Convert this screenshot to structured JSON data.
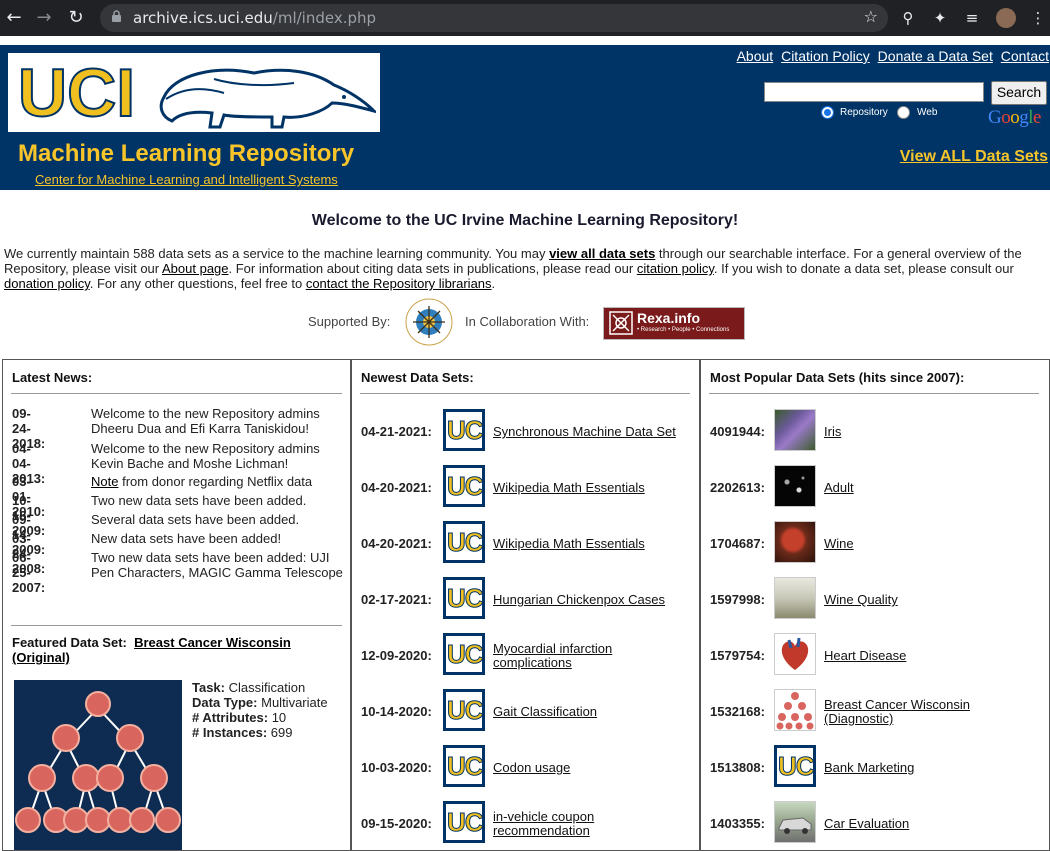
{
  "browser": {
    "url_host": "archive.ics.uci.edu",
    "url_path": "/ml/index.php"
  },
  "header": {
    "logo_text": "UCI",
    "title": "Machine Learning Repository",
    "subtitle_link": "Center for Machine Learning and Intelligent Systems",
    "links": [
      "About",
      "Citation Policy",
      "Donate a Data Set",
      "Contact"
    ],
    "search_button": "Search",
    "radio_options": [
      "Repository",
      "Web"
    ],
    "radio_selected": "Repository",
    "google_logo": "Google",
    "view_all": "View ALL Data Sets",
    "colors": {
      "bg": "#003366",
      "gold": "#f7c52a"
    }
  },
  "welcome": {
    "title": "Welcome to the UC Irvine Machine Learning Repository!",
    "intro": {
      "p1": "We currently maintain 588 data sets as a service to the machine learning community. You may ",
      "link1": "view all data sets",
      "p2": " through our searchable interface. For a general overview of the Repository, please visit our ",
      "link2": "About page",
      "p3": ". For information about citing data sets in publications, please read our ",
      "link3": "citation policy",
      "p4": ". If you wish to donate a data set, please consult our ",
      "link4": "donation policy",
      "p5": ". For any other questions, feel free to ",
      "link5": "contact the Repository librarians",
      "p6": "."
    },
    "supported_by": "Supported By:",
    "collaboration": "In Collaboration With:",
    "rexa_text": "Rexa.info",
    "rexa_sub": "• Research • People • Connections"
  },
  "news": {
    "title": "Latest News:",
    "items": [
      {
        "date": "09-24-2018:",
        "text": "Welcome to the new Repository admins Dheeru Dua and Efi Karra Taniskidou!"
      },
      {
        "date": "04-04-2013:",
        "text": "Welcome to the new Repository admins Kevin Bache and Moshe Lichman!"
      },
      {
        "date": "03-01-2010:",
        "link": "Note",
        "text": " from donor regarding Netflix data"
      },
      {
        "date": "10-16-2009:",
        "text": "Two new data sets have been added."
      },
      {
        "date": "09-14-2009:",
        "text": "Several data sets have been added."
      },
      {
        "date": "03-24-2008:",
        "text": "New data sets have been added!"
      },
      {
        "date": "06-25-2007:",
        "text": "Two new data sets have been added: UJI Pen Characters, MAGIC Gamma Telescope"
      }
    ],
    "featured_label": "Featured Data Set:",
    "featured_name": "Breast Cancer Wisconsin (Original)",
    "featured_info": [
      {
        "label": "Task:",
        "value": "Classification"
      },
      {
        "label": "Data Type:",
        "value": "Multivariate"
      },
      {
        "label": "# Attributes:",
        "value": "10"
      },
      {
        "label": "# Instances:",
        "value": "699"
      }
    ]
  },
  "newest": {
    "title": "Newest Data Sets:",
    "items": [
      {
        "date": "04-21-2021:",
        "name": "Synchronous Machine Data Set"
      },
      {
        "date": "04-20-2021:",
        "name": "Wikipedia Math Essentials"
      },
      {
        "date": "04-20-2021:",
        "name": "Wikipedia Math Essentials"
      },
      {
        "date": "02-17-2021:",
        "name": "Hungarian Chickenpox Cases"
      },
      {
        "date": "12-09-2020:",
        "name": "Myocardial infarction complications"
      },
      {
        "date": "10-14-2020:",
        "name": "Gait Classification"
      },
      {
        "date": "10-03-2020:",
        "name": "Codon usage"
      },
      {
        "date": "09-15-2020:",
        "name": "in-vehicle coupon recommendation"
      }
    ]
  },
  "popular": {
    "title": "Most Popular Data Sets (hits since 2007):",
    "items": [
      {
        "hits": "4091944:",
        "name": "Iris",
        "thumb": "iris-flower"
      },
      {
        "hits": "2202613:",
        "name": "Adult",
        "thumb": "adult-map"
      },
      {
        "hits": "1704687:",
        "name": "Wine",
        "thumb": "wine-glass"
      },
      {
        "hits": "1597998:",
        "name": "Wine Quality",
        "thumb": "wine-glasses"
      },
      {
        "hits": "1579754:",
        "name": "Heart Disease",
        "thumb": "heart"
      },
      {
        "hits": "1532168:",
        "name": "Breast Cancer Wisconsin (Diagnostic)",
        "thumb": "cell-tree"
      },
      {
        "hits": "1513808:",
        "name": "Bank Marketing",
        "thumb": "uci-logo"
      },
      {
        "hits": "1403355:",
        "name": "Car Evaluation",
        "thumb": "car"
      }
    ]
  }
}
